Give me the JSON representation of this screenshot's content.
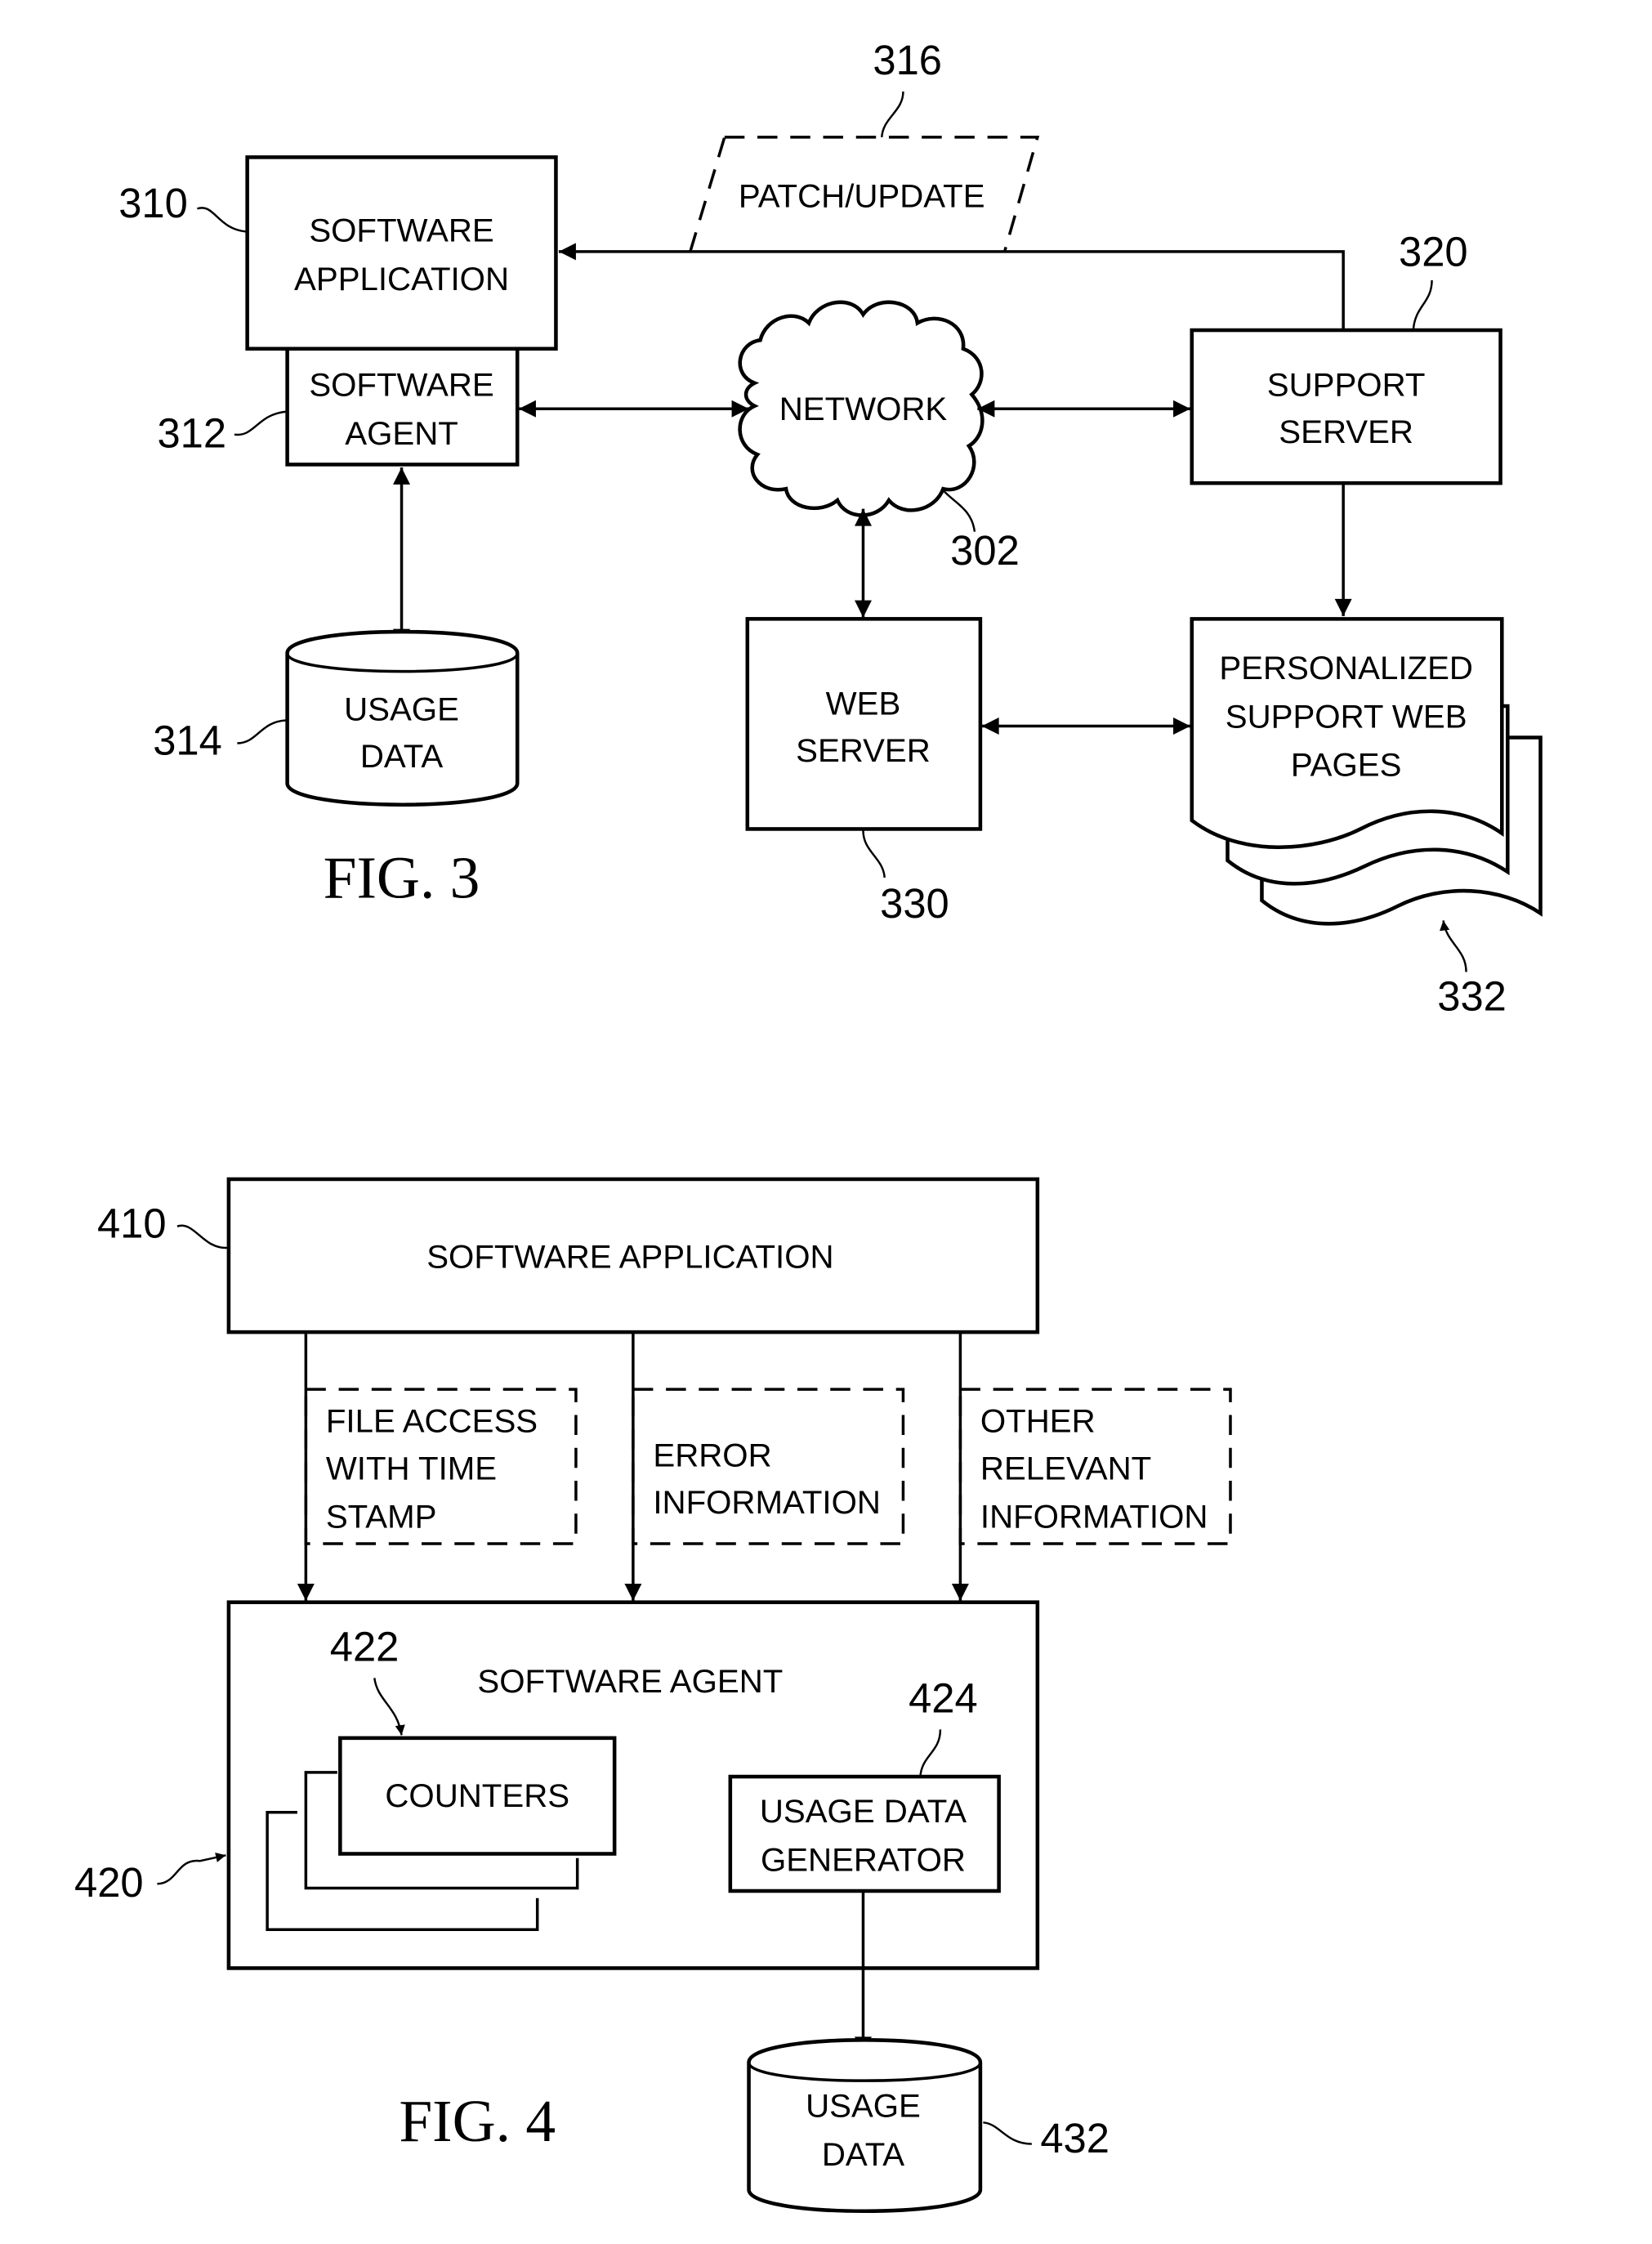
{
  "fig3": {
    "caption": "FIG. 3",
    "software_application": {
      "ref": "310",
      "lines": [
        "SOFTWARE",
        "APPLICATION"
      ]
    },
    "software_agent": {
      "ref": "312",
      "lines": [
        "SOFTWARE",
        "AGENT"
      ]
    },
    "usage_data": {
      "ref": "314",
      "lines": [
        "USAGE",
        "DATA"
      ]
    },
    "patch_update": {
      "ref": "316",
      "label": "PATCH/UPDATE"
    },
    "network": {
      "ref": "302",
      "label": "NETWORK"
    },
    "support_server": {
      "ref": "320",
      "lines": [
        "SUPPORT",
        "SERVER"
      ]
    },
    "web_server": {
      "ref": "330",
      "lines": [
        "WEB",
        "SERVER"
      ]
    },
    "personalized_pages": {
      "ref": "332",
      "lines": [
        "PERSONALIZED",
        "SUPPORT WEB",
        "PAGES"
      ]
    }
  },
  "fig4": {
    "caption": "FIG. 4",
    "software_application": {
      "ref": "410",
      "label": "SOFTWARE APPLICATION"
    },
    "data_flows": [
      {
        "lines": [
          "FILE ACCESS",
          "WITH TIME",
          "STAMP"
        ]
      },
      {
        "lines": [
          "ERROR",
          "INFORMATION"
        ]
      },
      {
        "lines": [
          "OTHER",
          "RELEVANT",
          "INFORMATION"
        ]
      }
    ],
    "software_agent": {
      "ref": "420",
      "label": "SOFTWARE AGENT"
    },
    "counters": {
      "ref": "422",
      "label": "COUNTERS"
    },
    "usage_data_generator": {
      "ref": "424",
      "lines": [
        "USAGE DATA",
        "GENERATOR"
      ]
    },
    "usage_data": {
      "ref": "432",
      "lines": [
        "USAGE",
        "DATA"
      ]
    }
  }
}
